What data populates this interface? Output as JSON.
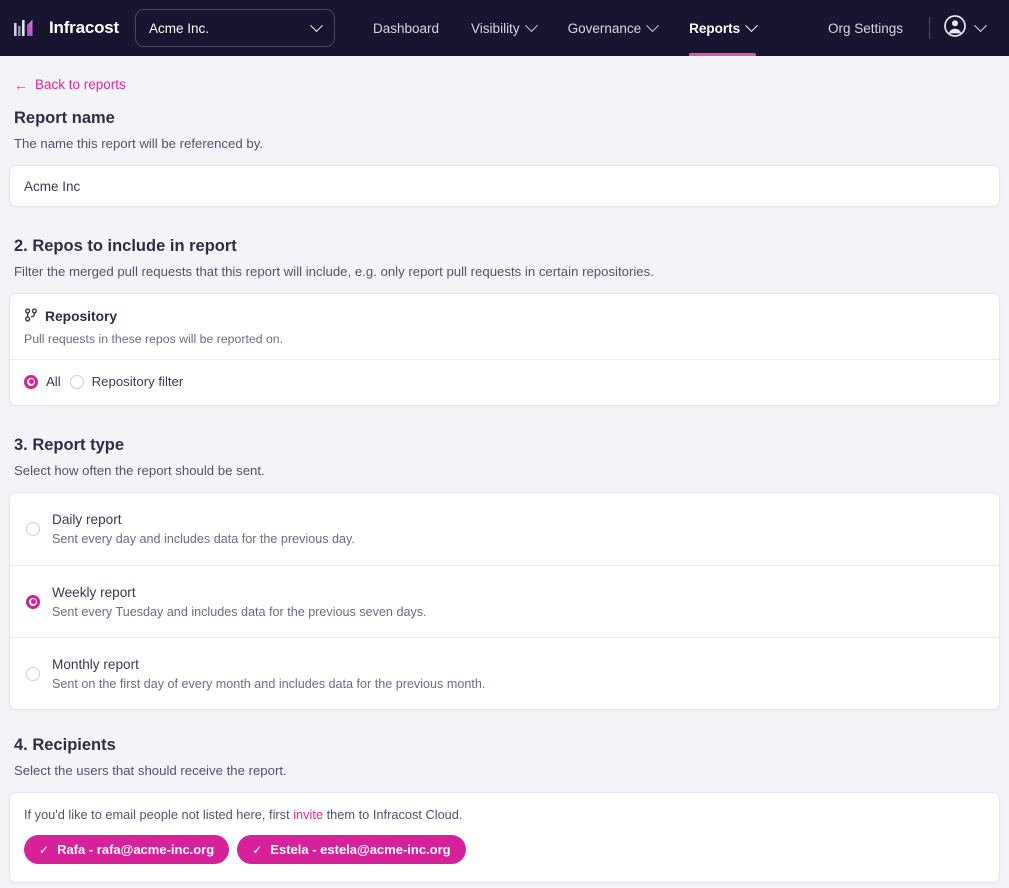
{
  "navbar": {
    "brand": "Infracost",
    "org_selector": {
      "value": "Acme Inc.",
      "icon": "chevron-down-icon"
    },
    "links": [
      {
        "label": "Dashboard",
        "has_caret": false,
        "active": false
      },
      {
        "label": "Visibility",
        "has_caret": true,
        "active": false
      },
      {
        "label": "Governance",
        "has_caret": true,
        "active": false
      },
      {
        "label": "Reports",
        "has_caret": true,
        "active": true
      }
    ],
    "org_settings": "Org Settings",
    "account_icon": "user-circle-icon",
    "account_caret": "chevron-down-icon",
    "accent": "#e054b4",
    "background": "#171530"
  },
  "back_link": {
    "arrow": "←",
    "label": "Back to reports"
  },
  "report_name": {
    "title": "Report name",
    "description": "The name this report will be referenced by.",
    "value": "Acme Inc",
    "placeholder": "Report name"
  },
  "repos": {
    "title": "2. Repos to include in report",
    "description": "Filter the merged pull requests that this report will include, e.g. only report pull requests in certain repositories.",
    "card": {
      "icon": "git-branch-icon",
      "title": "Repository",
      "subtitle": "Pull requests in these repos will be reported on.",
      "options": [
        {
          "label": "All",
          "selected": true
        },
        {
          "label": "Repository filter",
          "selected": false
        }
      ]
    }
  },
  "report_type": {
    "title": "3. Report type",
    "description": "Select how often the report should be sent.",
    "options": [
      {
        "label": "Daily report",
        "description": "Sent every day and includes data for the previous day.",
        "selected": false
      },
      {
        "label": "Weekly report",
        "description": "Sent every Tuesday and includes data for the previous seven days.",
        "selected": true
      },
      {
        "label": "Monthly report",
        "description": "Sent on the first day of every month and includes data for the previous month.",
        "selected": false
      }
    ]
  },
  "recipients": {
    "title": "4. Recipients",
    "description": "Select the users that should receive the report.",
    "note_before": "If you'd like to email people not listed here, first ",
    "note_link": "invite",
    "note_after": " them to Infracost Cloud.",
    "chips": [
      {
        "check": "✓",
        "label": "Rafa - rafa@acme-inc.org",
        "selected": true
      },
      {
        "check": "✓",
        "label": "Estela - estela@acme-inc.org",
        "selected": true
      }
    ],
    "chip_color": "#d6219b"
  }
}
